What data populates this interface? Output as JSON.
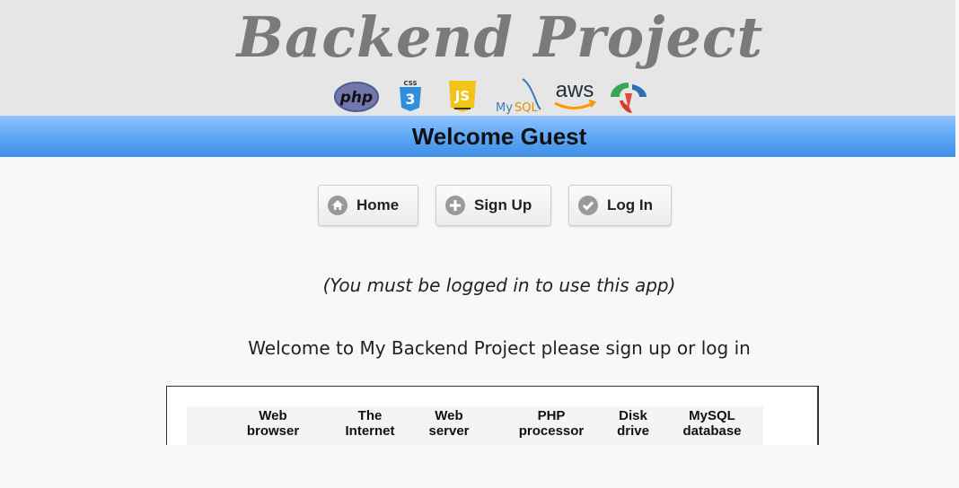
{
  "header": {
    "title": "Backend Project",
    "logos": [
      {
        "name": "php",
        "label": "php"
      },
      {
        "name": "css3",
        "label": "CSS"
      },
      {
        "name": "javascript",
        "label": "JS"
      },
      {
        "name": "mysql",
        "label": "MySQL"
      },
      {
        "name": "aws",
        "label": "aws"
      },
      {
        "name": "laravel-like",
        "label": ""
      }
    ]
  },
  "banner": {
    "text": "Welcome Guest"
  },
  "nav": {
    "home": "Home",
    "signup": "Sign Up",
    "login": "Log In"
  },
  "main": {
    "notice": "(You must be logged in to use this app)",
    "welcome": "Welcome to My Backend Project please sign up or log in"
  },
  "diagram": {
    "columns": [
      {
        "line1": "Web",
        "line2": "browser"
      },
      {
        "line1": "The",
        "line2": "Internet"
      },
      {
        "line1": "Web",
        "line2": "server"
      },
      {
        "line1": "PHP",
        "line2": "processor"
      },
      {
        "line1": "Disk",
        "line2": "drive"
      },
      {
        "line1": "MySQL",
        "line2": "database"
      }
    ]
  },
  "colors": {
    "title": "#7a7a7a",
    "banner": "#5ea8f6",
    "background": "#f8f8f8"
  }
}
